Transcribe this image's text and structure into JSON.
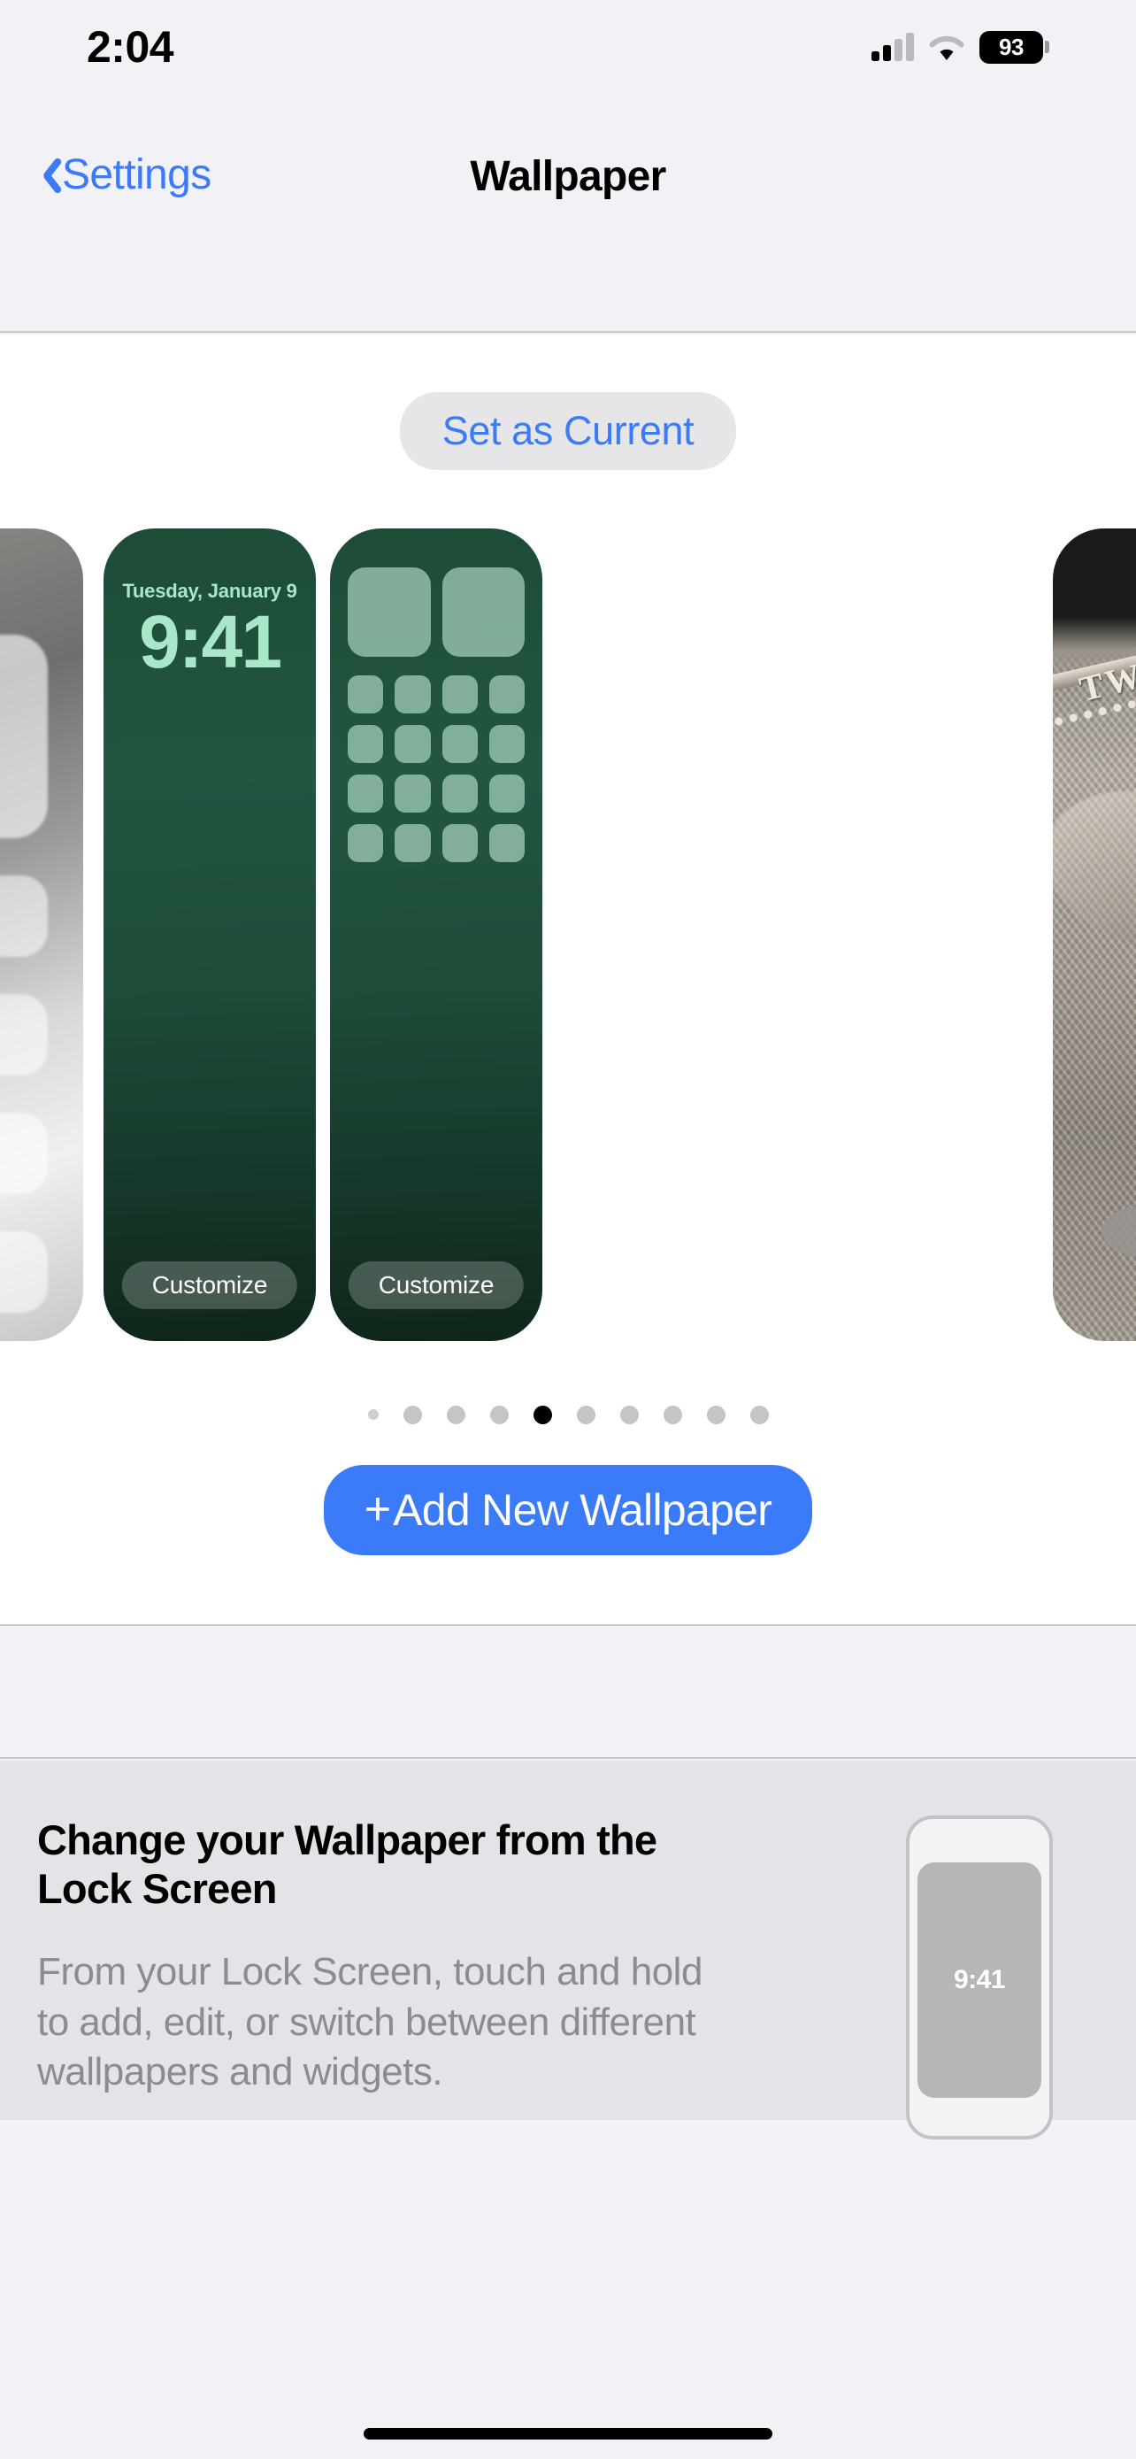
{
  "status_bar": {
    "time": "2:04",
    "battery_percent": "93",
    "cellular_icon": "cellular-signal-icon",
    "wifi_icon": "wifi-icon",
    "battery_icon": "battery-icon"
  },
  "nav": {
    "back_label": "Settings",
    "back_icon": "chevron-left-icon",
    "title": "Wallpaper"
  },
  "carousel": {
    "set_as_current_label": "Set as Current",
    "lock_screen": {
      "date": "Tuesday, January 9",
      "time": "9:41",
      "customize_label": "Customize"
    },
    "home_screen": {
      "customize_label": "Customize"
    },
    "page_dots": {
      "total": 10,
      "active_index": 5
    }
  },
  "add_button": {
    "plus": "+",
    "label": "Add New Wallpaper"
  },
  "info_card": {
    "title": "Change your Wallpaper from the Lock Screen",
    "body": "From your Lock Screen, touch and hold to add, edit, or switch between different wallpapers and widgets.",
    "preview_time": "9:41"
  },
  "colors": {
    "accent_blue": "#3b7bf7",
    "page_background": "#f2f1f6",
    "card_background": "#ffffff",
    "info_card_background": "#e4e4e8",
    "wallpaper_green": "#1d4c37",
    "wallpaper_green_dark": "#0f2619",
    "lock_text_mint": "#a9e7cb",
    "dot_active": "#000000",
    "dot_inactive": "#c5c5c7"
  }
}
